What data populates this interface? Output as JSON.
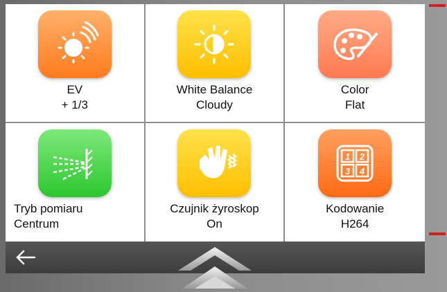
{
  "tiles": [
    {
      "id": "ev",
      "line1": "EV",
      "line2": "+ 1/3",
      "icon": "sun-brightness-icon",
      "color": "#ff8a2e"
    },
    {
      "id": "white-balance",
      "line1": "White Balance",
      "line2": "Cloudy",
      "icon": "white-balance-icon",
      "color": "#ffcc12"
    },
    {
      "id": "color",
      "line1": "Color",
      "line2": "Flat",
      "icon": "palette-icon",
      "color": "#ff8b60"
    },
    {
      "id": "metering",
      "line1": "Tryb pomiaru",
      "line2": "Centrum",
      "icon": "metering-icon",
      "color": "#3ed03c"
    },
    {
      "id": "gyro",
      "line1": "Czujnik żyroskop",
      "line2": "On",
      "icon": "hand-vibration-icon",
      "color": "#ffc800"
    },
    {
      "id": "encoding",
      "line1": "Kodowanie",
      "line2": "H264",
      "icon": "grid-1234-icon",
      "color": "#ff7a22"
    }
  ],
  "encoding_digits": [
    "1",
    "2",
    "3",
    "4"
  ],
  "bottom_bar": {
    "back_icon": "arrow-left-icon",
    "expand_icon": "chevron-up-icon"
  },
  "accent_color": "#d21f1f"
}
